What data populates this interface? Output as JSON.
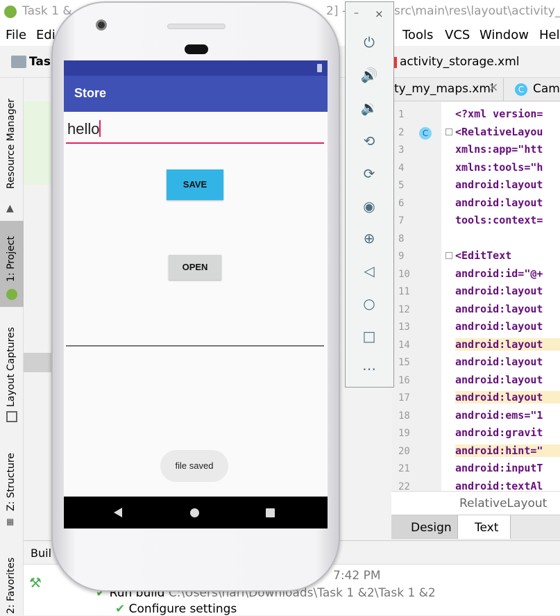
{
  "ide": {
    "title_left": "Task 1 &",
    "title_right": "src\\main\\res\\layout\\activity_sto",
    "title_mid": "2] -",
    "menu": [
      "File",
      "Edi",
      "Tools",
      "VCS",
      "Window",
      "Help"
    ],
    "project_label": "Task",
    "open_file": "activity_storage.xml",
    "tabs": [
      "ty_my_maps.xml",
      "Cam"
    ],
    "left_tool_tabs": [
      "Resource Manager",
      "1: Project",
      "Layout Captures",
      "Z: Structure",
      "2: Favorites"
    ],
    "line_numbers": [
      "1",
      "2",
      "3",
      "4",
      "5",
      "6",
      "7",
      "8",
      "9",
      "10",
      "11",
      "12",
      "13",
      "14",
      "15",
      "16",
      "17",
      "18",
      "19",
      "20",
      "21",
      "22"
    ],
    "code_lines": [
      "<?xml version=",
      "<RelativeLayou",
      "xmlns:app=\"htt",
      "xmlns:tools=\"h",
      "android:layout",
      "android:layout",
      "tools:context=",
      "",
      "<EditText",
      "android:id=\"@+",
      "android:layout",
      "android:layout",
      "android:layout",
      "android:layout",
      "android:layout",
      "android:layout",
      "android:layout",
      "android:ems=\"1",
      "android:gravit",
      "android:hint=\"",
      "android:inputT",
      "android:textAl"
    ],
    "breadcrumb": "RelativeLayout",
    "design_tab": "Design",
    "text_tab": "Text",
    "build_tab": "Buil",
    "build_time": "7:42 PM",
    "build_run": "Run build",
    "build_path": "C:\\Users\\hari\\Downloads\\Task 1 &2\\Task 1 &2",
    "build_configure": "Configure settings"
  },
  "emulator_panel": {
    "minimize": "–",
    "close": "×",
    "buttons": [
      "power-icon",
      "volume-up-icon",
      "volume-down-icon",
      "rotate-left-icon",
      "rotate-right-icon",
      "camera-icon",
      "zoom-icon",
      "back-icon",
      "home-icon",
      "overview-icon",
      "more-icon"
    ]
  },
  "app": {
    "title": "Store",
    "input_value": "hello",
    "save_label": "SAVE",
    "open_label": "OPEN",
    "toast": "file saved"
  },
  "colors": {
    "app_bar": "#3f51b5",
    "status_bar": "#303f9f",
    "save_button": "#32b4e6",
    "accent": "#e91e63"
  }
}
